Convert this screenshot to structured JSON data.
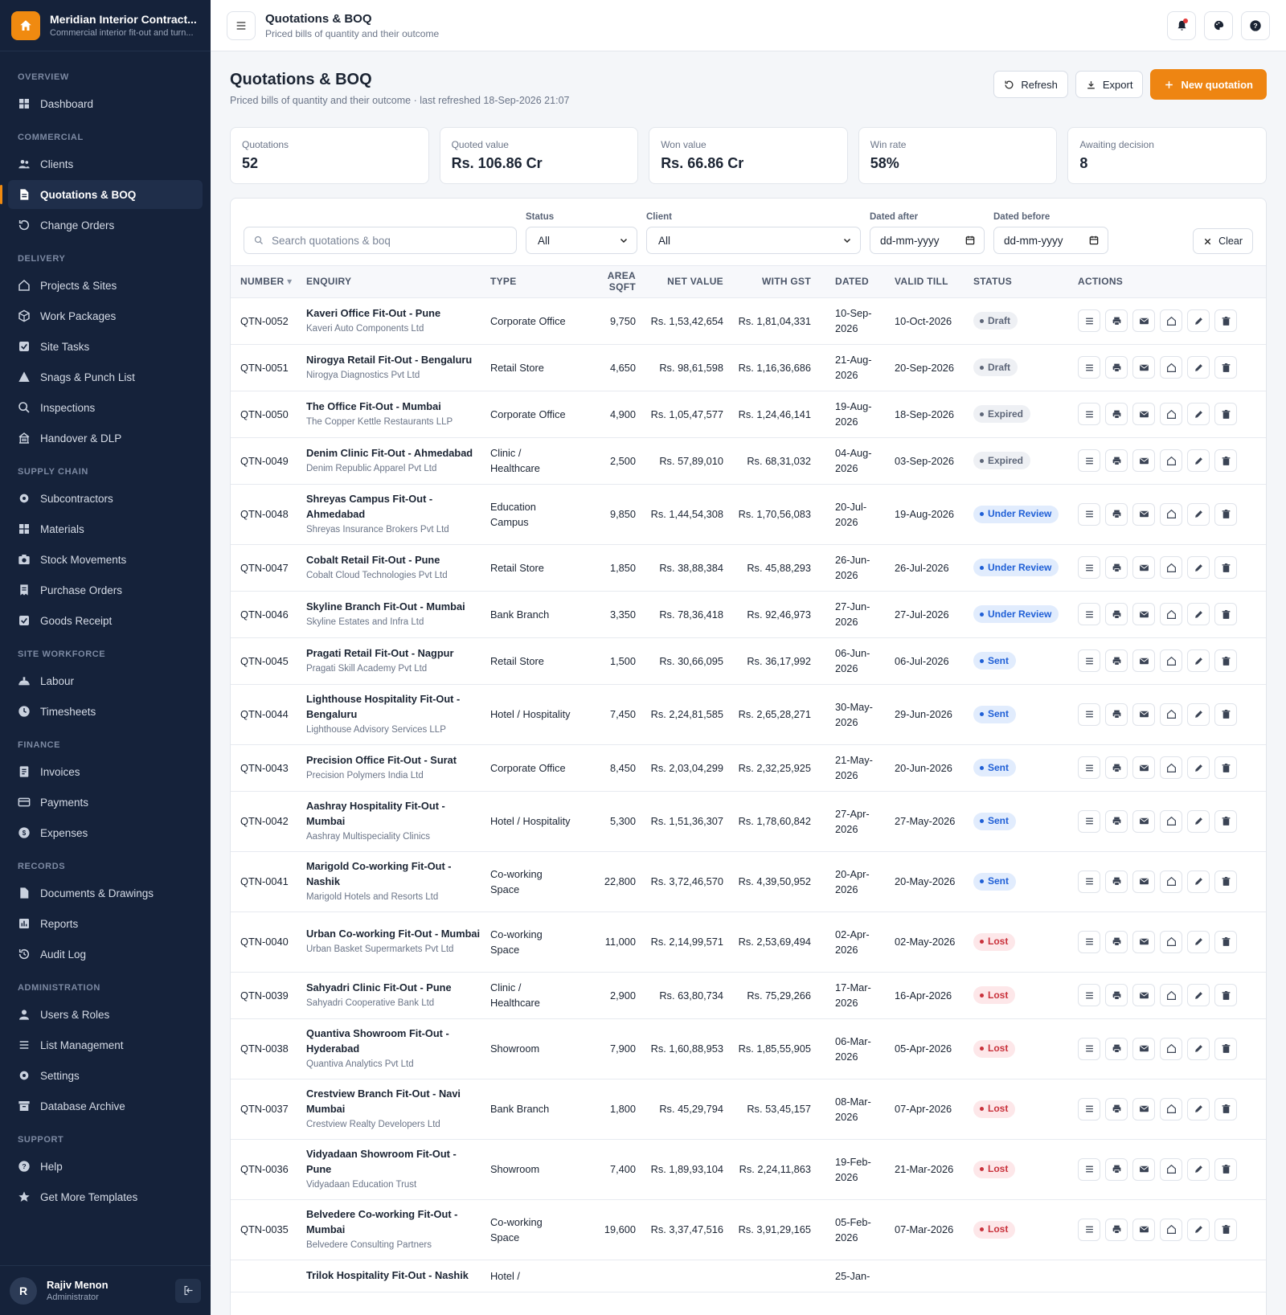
{
  "brand": {
    "title": "Meridian Interior Contract...",
    "subtitle": "Commercial interior fit-out and turn..."
  },
  "sidebar": {
    "sections": [
      {
        "label": "OVERVIEW",
        "items": [
          {
            "label": "Dashboard",
            "icon": "dashboard-icon"
          }
        ]
      },
      {
        "label": "COMMERCIAL",
        "items": [
          {
            "label": "Clients",
            "icon": "users-icon"
          },
          {
            "label": "Quotations & BOQ",
            "icon": "document-icon",
            "active": true
          },
          {
            "label": "Change Orders",
            "icon": "refresh-icon"
          }
        ]
      },
      {
        "label": "DELIVERY",
        "items": [
          {
            "label": "Projects & Sites",
            "icon": "home-icon"
          },
          {
            "label": "Work Packages",
            "icon": "box-icon"
          },
          {
            "label": "Site Tasks",
            "icon": "checkbox-icon"
          },
          {
            "label": "Snags & Punch List",
            "icon": "warning-icon"
          },
          {
            "label": "Inspections",
            "icon": "search-icon"
          },
          {
            "label": "Handover & DLP",
            "icon": "building-icon"
          }
        ]
      },
      {
        "label": "SUPPLY CHAIN",
        "items": [
          {
            "label": "Subcontractors",
            "icon": "gear-icon"
          },
          {
            "label": "Materials",
            "icon": "grid-icon"
          },
          {
            "label": "Stock Movements",
            "icon": "camera-icon"
          },
          {
            "label": "Purchase Orders",
            "icon": "receipt-icon"
          },
          {
            "label": "Goods Receipt",
            "icon": "checkbox-icon"
          }
        ]
      },
      {
        "label": "SITE WORKFORCE",
        "items": [
          {
            "label": "Labour",
            "icon": "helmet-icon"
          },
          {
            "label": "Timesheets",
            "icon": "clock-icon"
          }
        ]
      },
      {
        "label": "FINANCE",
        "items": [
          {
            "label": "Invoices",
            "icon": "invoice-icon"
          },
          {
            "label": "Payments",
            "icon": "card-icon"
          },
          {
            "label": "Expenses",
            "icon": "coin-icon"
          }
        ]
      },
      {
        "label": "RECORDS",
        "items": [
          {
            "label": "Documents & Drawings",
            "icon": "file-icon"
          },
          {
            "label": "Reports",
            "icon": "chart-icon"
          },
          {
            "label": "Audit Log",
            "icon": "history-icon"
          }
        ]
      },
      {
        "label": "ADMINISTRATION",
        "items": [
          {
            "label": "Users & Roles",
            "icon": "user-icon"
          },
          {
            "label": "List Management",
            "icon": "list-icon"
          },
          {
            "label": "Settings",
            "icon": "gear-icon"
          },
          {
            "label": "Database Archive",
            "icon": "archive-icon"
          }
        ]
      },
      {
        "label": "SUPPORT",
        "items": [
          {
            "label": "Help",
            "icon": "help-icon"
          },
          {
            "label": "Get More Templates",
            "icon": "star-icon"
          }
        ]
      }
    ]
  },
  "user": {
    "initial": "R",
    "name": "Rajiv Menon",
    "role": "Administrator"
  },
  "topbar": {
    "title": "Quotations & BOQ",
    "subtitle": "Priced bills of quantity and their outcome"
  },
  "page": {
    "title": "Quotations & BOQ",
    "subtitle": "Priced bills of quantity and their outcome · last refreshed 18-Sep-2026 21:07",
    "refresh_label": "Refresh",
    "export_label": "Export",
    "new_label": "New quotation"
  },
  "kpis": [
    {
      "label": "Quotations",
      "value": "52"
    },
    {
      "label": "Quoted value",
      "value": "Rs. 106.86 Cr"
    },
    {
      "label": "Won value",
      "value": "Rs. 66.86 Cr"
    },
    {
      "label": "Win rate",
      "value": "58%"
    },
    {
      "label": "Awaiting decision",
      "value": "8"
    }
  ],
  "filters": {
    "search_placeholder": "Search quotations & boq",
    "status_label": "Status",
    "status_value": "All",
    "client_label": "Client",
    "client_value": "All",
    "after_label": "Dated after",
    "after_value": "dd-mm-yyyy",
    "before_label": "Dated before",
    "before_value": "dd-mm-yyyy",
    "clear_label": "Clear"
  },
  "table": {
    "headers": {
      "number": "NUMBER",
      "enquiry": "ENQUIRY",
      "type": "TYPE",
      "area": "AREA SQFT",
      "net": "NET VALUE",
      "gst": "WITH GST",
      "dated": "DATED",
      "valid": "VALID TILL",
      "status": "STATUS",
      "actions": "ACTIONS"
    },
    "sort_indicator": "▾",
    "rows": [
      {
        "number": "QTN-0052",
        "title": "Kaveri Office Fit-Out - Pune",
        "client": "Kaveri Auto Components Ltd",
        "type": "Corporate Office",
        "area": "9,750",
        "net": "Rs. 1,53,42,654",
        "gst": "Rs. 1,81,04,331",
        "dated": "10-Sep-2026",
        "valid": "10-Oct-2026",
        "status": "Draft",
        "kind": "draft"
      },
      {
        "number": "QTN-0051",
        "title": "Nirogya Retail Fit-Out - Bengaluru",
        "client": "Nirogya Diagnostics Pvt Ltd",
        "type": "Retail Store",
        "area": "4,650",
        "net": "Rs. 98,61,598",
        "gst": "Rs. 1,16,36,686",
        "dated": "21-Aug-2026",
        "valid": "20-Sep-2026",
        "status": "Draft",
        "kind": "draft"
      },
      {
        "number": "QTN-0050",
        "title": "The Office Fit-Out - Mumbai",
        "client": "The Copper Kettle Restaurants LLP",
        "type": "Corporate Office",
        "area": "4,900",
        "net": "Rs. 1,05,47,577",
        "gst": "Rs. 1,24,46,141",
        "dated": "19-Aug-2026",
        "valid": "18-Sep-2026",
        "status": "Expired",
        "kind": "expired"
      },
      {
        "number": "QTN-0049",
        "title": "Denim Clinic Fit-Out - Ahmedabad",
        "client": "Denim Republic Apparel Pvt Ltd",
        "type": "Clinic / Healthcare",
        "area": "2,500",
        "net": "Rs. 57,89,010",
        "gst": "Rs. 68,31,032",
        "dated": "04-Aug-2026",
        "valid": "03-Sep-2026",
        "status": "Expired",
        "kind": "expired"
      },
      {
        "number": "QTN-0048",
        "title": "Shreyas Campus Fit-Out - Ahmedabad",
        "client": "Shreyas Insurance Brokers Pvt Ltd",
        "type": "Education Campus",
        "area": "9,850",
        "net": "Rs. 1,44,54,308",
        "gst": "Rs. 1,70,56,083",
        "dated": "20-Jul-2026",
        "valid": "19-Aug-2026",
        "status": "Under Review",
        "kind": "review"
      },
      {
        "number": "QTN-0047",
        "title": "Cobalt Retail Fit-Out - Pune",
        "client": "Cobalt Cloud Technologies Pvt Ltd",
        "type": "Retail Store",
        "area": "1,850",
        "net": "Rs. 38,88,384",
        "gst": "Rs. 45,88,293",
        "dated": "26-Jun-2026",
        "valid": "26-Jul-2026",
        "status": "Under Review",
        "kind": "review"
      },
      {
        "number": "QTN-0046",
        "title": "Skyline Branch Fit-Out - Mumbai",
        "client": "Skyline Estates and Infra Ltd",
        "type": "Bank Branch",
        "area": "3,350",
        "net": "Rs. 78,36,418",
        "gst": "Rs. 92,46,973",
        "dated": "27-Jun-2026",
        "valid": "27-Jul-2026",
        "status": "Under Review",
        "kind": "review"
      },
      {
        "number": "QTN-0045",
        "title": "Pragati Retail Fit-Out - Nagpur",
        "client": "Pragati Skill Academy Pvt Ltd",
        "type": "Retail Store",
        "area": "1,500",
        "net": "Rs. 30,66,095",
        "gst": "Rs. 36,17,992",
        "dated": "06-Jun-2026",
        "valid": "06-Jul-2026",
        "status": "Sent",
        "kind": "sent"
      },
      {
        "number": "QTN-0044",
        "title": "Lighthouse Hospitality Fit-Out - Bengaluru",
        "client": "Lighthouse Advisory Services LLP",
        "type": "Hotel / Hospitality",
        "area": "7,450",
        "net": "Rs. 2,24,81,585",
        "gst": "Rs. 2,65,28,271",
        "dated": "30-May-2026",
        "valid": "29-Jun-2026",
        "status": "Sent",
        "kind": "sent"
      },
      {
        "number": "QTN-0043",
        "title": "Precision Office Fit-Out - Surat",
        "client": "Precision Polymers India Ltd",
        "type": "Corporate Office",
        "area": "8,450",
        "net": "Rs. 2,03,04,299",
        "gst": "Rs. 2,32,25,925",
        "dated": "21-May-2026",
        "valid": "20-Jun-2026",
        "status": "Sent",
        "kind": "sent"
      },
      {
        "number": "QTN-0042",
        "title": "Aashray Hospitality Fit-Out - Mumbai",
        "client": "Aashray Multispeciality Clinics",
        "type": "Hotel / Hospitality",
        "area": "5,300",
        "net": "Rs. 1,51,36,307",
        "gst": "Rs. 1,78,60,842",
        "dated": "27-Apr-2026",
        "valid": "27-May-2026",
        "status": "Sent",
        "kind": "sent"
      },
      {
        "number": "QTN-0041",
        "title": "Marigold Co-working Fit-Out - Nashik",
        "client": "Marigold Hotels and Resorts Ltd",
        "type": "Co-working Space",
        "area": "22,800",
        "net": "Rs. 3,72,46,570",
        "gst": "Rs. 4,39,50,952",
        "dated": "20-Apr-2026",
        "valid": "20-May-2026",
        "status": "Sent",
        "kind": "sent"
      },
      {
        "number": "QTN-0040",
        "title": "Urban Co-working Fit-Out - Mumbai",
        "client": "Urban Basket Supermarkets Pvt Ltd",
        "type": "Co-working Space",
        "area": "11,000",
        "net": "Rs. 2,14,99,571",
        "gst": "Rs. 2,53,69,494",
        "dated": "02-Apr-2026",
        "valid": "02-May-2026",
        "status": "Lost",
        "kind": "lost"
      },
      {
        "number": "QTN-0039",
        "title": "Sahyadri Clinic Fit-Out - Pune",
        "client": "Sahyadri Cooperative Bank Ltd",
        "type": "Clinic / Healthcare",
        "area": "2,900",
        "net": "Rs. 63,80,734",
        "gst": "Rs. 75,29,266",
        "dated": "17-Mar-2026",
        "valid": "16-Apr-2026",
        "status": "Lost",
        "kind": "lost"
      },
      {
        "number": "QTN-0038",
        "title": "Quantiva Showroom Fit-Out - Hyderabad",
        "client": "Quantiva Analytics Pvt Ltd",
        "type": "Showroom",
        "area": "7,900",
        "net": "Rs. 1,60,88,953",
        "gst": "Rs. 1,85,55,905",
        "dated": "06-Mar-2026",
        "valid": "05-Apr-2026",
        "status": "Lost",
        "kind": "lost"
      },
      {
        "number": "QTN-0037",
        "title": "Crestview Branch Fit-Out - Navi Mumbai",
        "client": "Crestview Realty Developers Ltd",
        "type": "Bank Branch",
        "area": "1,800",
        "net": "Rs. 45,29,794",
        "gst": "Rs. 53,45,157",
        "dated": "08-Mar-2026",
        "valid": "07-Apr-2026",
        "status": "Lost",
        "kind": "lost"
      },
      {
        "number": "QTN-0036",
        "title": "Vidyadaan Showroom Fit-Out - Pune",
        "client": "Vidyadaan Education Trust",
        "type": "Showroom",
        "area": "7,400",
        "net": "Rs. 1,89,93,104",
        "gst": "Rs. 2,24,11,863",
        "dated": "19-Feb-2026",
        "valid": "21-Mar-2026",
        "status": "Lost",
        "kind": "lost"
      },
      {
        "number": "QTN-0035",
        "title": "Belvedere Co-working Fit-Out - Mumbai",
        "client": "Belvedere Consulting Partners",
        "type": "Co-working Space",
        "area": "19,600",
        "net": "Rs. 3,37,47,516",
        "gst": "Rs. 3,91,29,165",
        "dated": "05-Feb-2026",
        "valid": "07-Mar-2026",
        "status": "Lost",
        "kind": "lost"
      },
      {
        "number": "",
        "title": "Trilok Hospitality Fit-Out - Nashik",
        "client": "",
        "type": "Hotel /",
        "area": "",
        "net": "",
        "gst": "",
        "dated": "25-Jan-",
        "valid": "",
        "status": "",
        "kind": "lost"
      }
    ]
  },
  "colors": {
    "accent": "#ee8512",
    "sidebar": "#15223a",
    "sent": "#1f5fd6",
    "lost": "#c9323c"
  }
}
